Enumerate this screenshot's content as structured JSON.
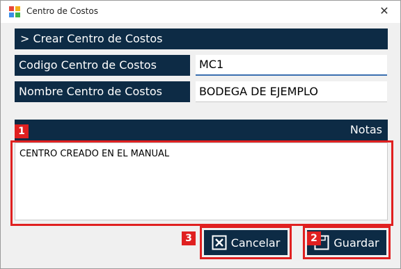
{
  "window": {
    "title": "Centro de Costos",
    "close_symbol": "✕",
    "app_icon": "app-logo-icon"
  },
  "form": {
    "header": "> Crear Centro de Costos",
    "codigo": {
      "label": "Codigo Centro de Costos",
      "value": "MC1"
    },
    "nombre": {
      "label": "Nombre Centro de Costos",
      "value": "BODEGA DE EJEMPLO"
    },
    "notas": {
      "label": "Notas",
      "value": "CENTRO CREADO EN EL MANUAL"
    }
  },
  "buttons": {
    "cancel_label": "Cancelar",
    "cancel_icon": "cancel-x-icon",
    "save_label": "Guardar",
    "save_icon": "save-icon"
  },
  "annotations": {
    "badge_1": "1",
    "badge_2": "2",
    "badge_3": "3",
    "highlight_color": "#e02020"
  },
  "colors": {
    "header_bg": "#0d2b45",
    "window_bg": "#f0f0f0"
  }
}
